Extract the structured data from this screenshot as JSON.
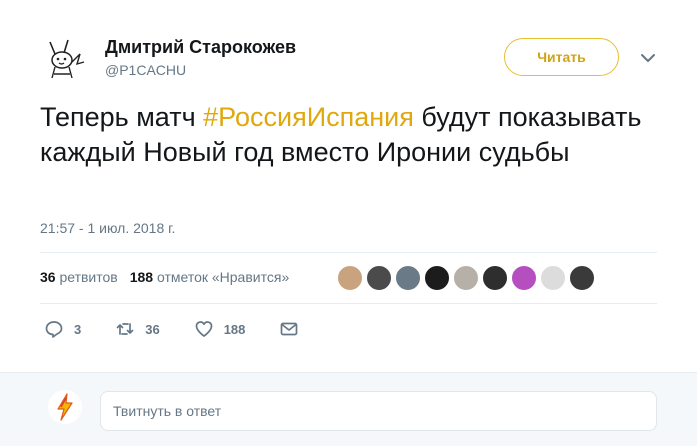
{
  "author": {
    "display_name": "Дмитрий Старокожев",
    "handle": "@P1CACHU",
    "avatar_icon": "pikachu-sketch-avatar"
  },
  "follow_button": {
    "label": "Читать",
    "accent": "#e0a80d"
  },
  "menu_icon": "chevron-down-icon",
  "tweet": {
    "text_before": "Теперь матч ",
    "hashtag": "#РоссияИспания",
    "text_after": " будут показывать каждый Новый год вместо Иронии судьбы",
    "hashtag_color": "#e0a80d",
    "timestamp": "21:57 - 1 июл. 2018 г."
  },
  "stats": {
    "retweets_count": "36",
    "retweets_label": "ретвитов",
    "likes_count": "188",
    "likes_label": "отметок «Нравится»"
  },
  "liker_avatars": [
    {
      "name": "liker-1",
      "color": "#c9a37e"
    },
    {
      "name": "liker-2",
      "color": "#4b4b4b"
    },
    {
      "name": "liker-3",
      "color": "#6a7a86"
    },
    {
      "name": "liker-4",
      "color": "#1c1c1c"
    },
    {
      "name": "liker-5",
      "color": "#b7b0a8"
    },
    {
      "name": "liker-6",
      "color": "#2e2e2e"
    },
    {
      "name": "liker-7",
      "color": "#b54fc0"
    },
    {
      "name": "liker-8",
      "color": "#dcdcdc"
    },
    {
      "name": "liker-9",
      "color": "#3a3a3a"
    }
  ],
  "actions": {
    "replies": "3",
    "retweets": "36",
    "likes": "188"
  },
  "reply": {
    "placeholder": "Твитнуть в ответ",
    "avatar_icon": "lightning-avatar"
  }
}
